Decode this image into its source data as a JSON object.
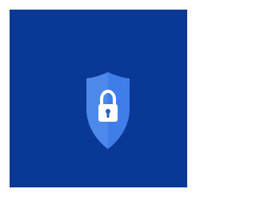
{
  "app_icon": {
    "icon": "shield-lock-icon",
    "colors": {
      "tile_background": "#0a3896",
      "shield_fill": "#3f7ee8",
      "shield_highlight": "#5f94ef",
      "lock_body": "#ffffff",
      "keyhole": "#1e5fc8"
    }
  }
}
